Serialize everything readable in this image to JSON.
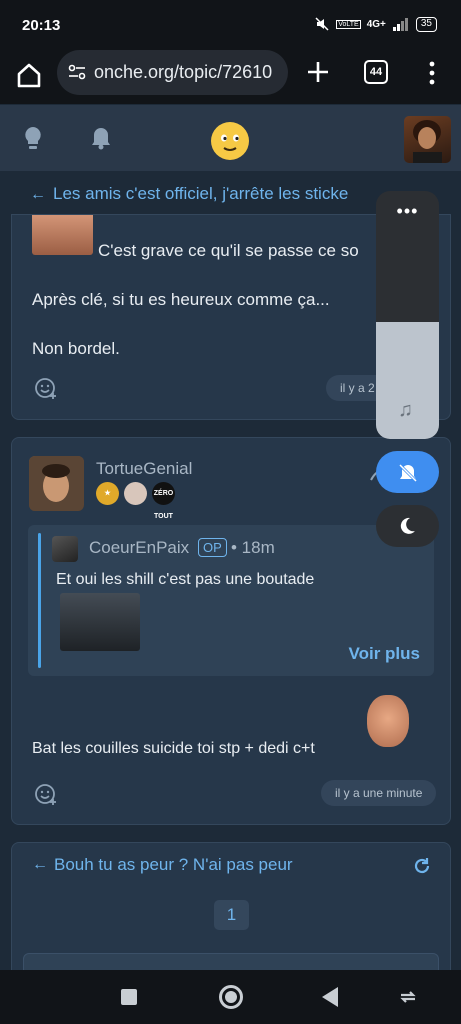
{
  "status": {
    "time": "20:13",
    "network": "4G+",
    "volte": "VoLTE",
    "battery": "35",
    "icons": [
      "mute-icon",
      "volte-icon",
      "signal-icon",
      "battery-icon"
    ]
  },
  "browser": {
    "url": "onche.org/topic/72610",
    "tab_count": "44",
    "icons": [
      "home-icon",
      "site-settings-icon",
      "plus-icon",
      "tabs-icon",
      "kebab-menu-icon"
    ]
  },
  "header": {
    "icons": [
      "bulb-icon",
      "bell-icon",
      "smiley-logo-icon",
      "user-avatar"
    ]
  },
  "topic": {
    "back_arrow": "←",
    "title": "Les amis c'est officiel, j'arrête les sticke"
  },
  "post1": {
    "line1": "C'est grave ce qu'il se passe ce so",
    "line2": "Après clé, si tu es heureux comme ça...",
    "line3": "Non bordel.",
    "time": "il y a 2"
  },
  "post2": {
    "username": "TortueGenial",
    "badges": [
      "star-badge",
      "avatar-badge",
      "zero-tout-badge"
    ],
    "badge_text": "ZÉRO TOUT",
    "quote": {
      "username": "CoeurEnPaix",
      "op_label": "OP",
      "time": "• 18m",
      "text": "Et oui les shill c'est pas une boutade",
      "more_label": "Voir plus"
    },
    "text": "Bat les couilles suicide toi stp + dedi c+t",
    "time": "il y a une minute"
  },
  "related": {
    "back_arrow": "←",
    "title": "Bouh tu as peur ? N'ai pas peur",
    "page": "1"
  },
  "floating": {
    "dots": "•••",
    "music": "♫"
  },
  "colors": {
    "accent": "#6fb4ec",
    "card": "#26374a",
    "background": "#1d2a38",
    "mute_button": "#3f8ef0"
  }
}
